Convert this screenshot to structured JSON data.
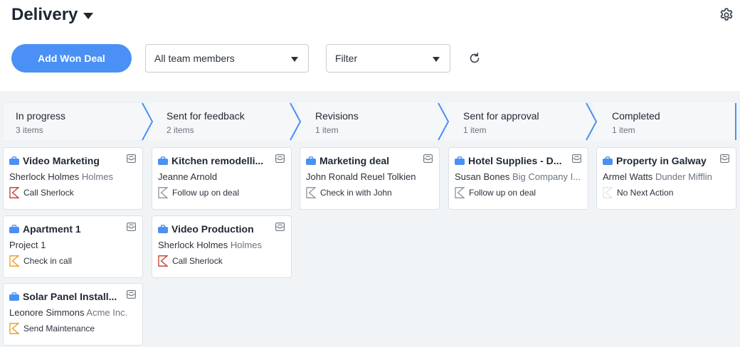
{
  "header": {
    "title": "Delivery",
    "add_button_label": "Add Won Deal",
    "members_select": "All team members",
    "filter_select": "Filter"
  },
  "colors": {
    "accent": "#4a90f5",
    "stage_chevron": "#4a90f5",
    "flag_overdue": "#c0392b",
    "flag_today": "#e79a25",
    "flag_future": "#8c939c",
    "flag_none": "#c2c7cd"
  },
  "stages": [
    {
      "name": "In progress",
      "count": "3 items"
    },
    {
      "name": "Sent for feedback",
      "count": "2 items"
    },
    {
      "name": "Revisions",
      "count": "1 item"
    },
    {
      "name": "Sent for approval",
      "count": "1 item"
    },
    {
      "name": "Completed",
      "count": "1 item"
    }
  ],
  "cards": [
    {
      "title": "Video Marketing",
      "person": "Sherlock Holmes",
      "org": "Holmes",
      "action": "Call Sherlock",
      "flag": "overdue"
    },
    {
      "title": "Apartment 1",
      "person": "Project 1",
      "org": "",
      "action": "Check in call",
      "flag": "today"
    },
    {
      "title": "Solar Panel Install...",
      "person": "Leonore Simmons",
      "org": "Acme Inc.",
      "action": "Send Maintenance",
      "flag": "today"
    },
    {
      "title": "Kitchen remodelli...",
      "person": "Jeanne Arnold",
      "org": "",
      "action": "Follow up on deal",
      "flag": "future"
    },
    {
      "title": "Video Production",
      "person": "Sherlock Holmes",
      "org": "Holmes",
      "action": "Call Sherlock",
      "flag": "overdue"
    },
    {
      "title": "Marketing deal",
      "person": "John Ronald Reuel Tolkien",
      "org": "",
      "action": "Check in with John",
      "flag": "future"
    },
    {
      "title": "Hotel Supplies - D...",
      "person": "Susan Bones",
      "org": "Big Company I...",
      "action": "Follow up on deal",
      "flag": "future"
    },
    {
      "title": "Property in Galway",
      "person": "Armel Watts",
      "org": "Dunder Mifflin",
      "action": "No Next Action",
      "flag": "none"
    }
  ]
}
